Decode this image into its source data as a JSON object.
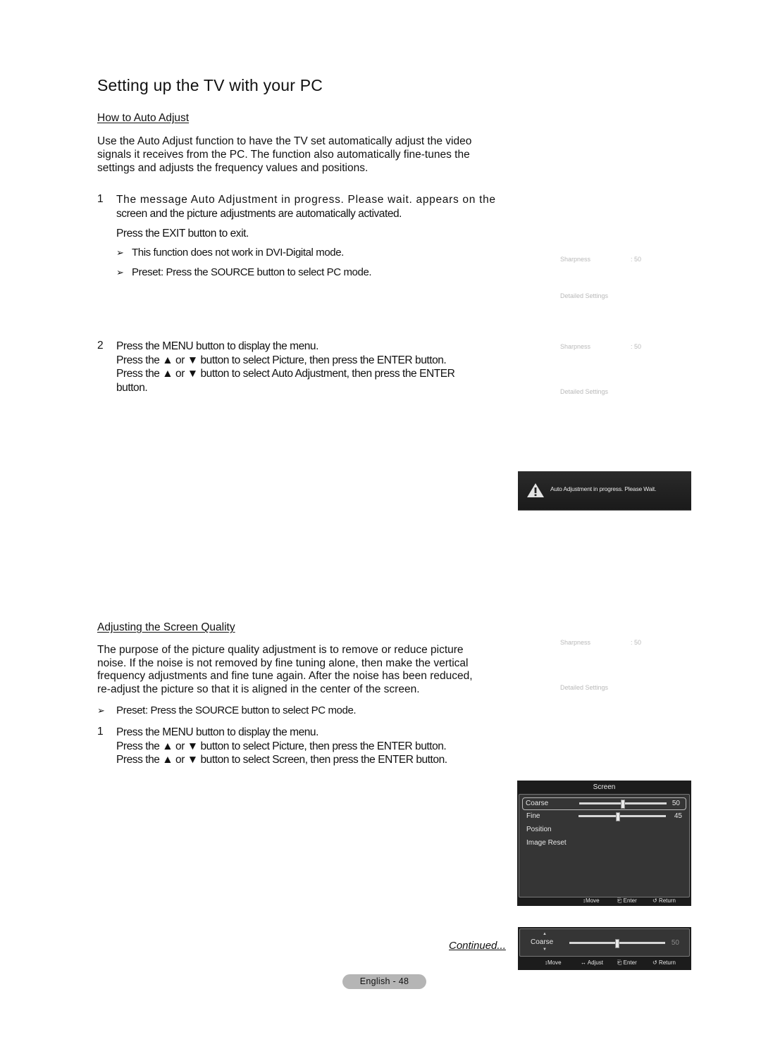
{
  "page": {
    "title": "Setting up the TV with your PC",
    "continued_label": "Continued...",
    "page_label": "English - 48"
  },
  "auto_adjust": {
    "heading": "How to Auto Adjust",
    "intro": [
      "Use the Auto Adjust function to have the TV set automatically adjust the video",
      "signals it receives from the PC. The function also automatically fine-tunes the",
      "settings and adjusts the frequency values and positions."
    ],
    "step1": {
      "number": "1",
      "line1": "The message Auto Adjustment in progress. Please wait. appears on the",
      "line2": "screen and the picture adjustments are automatically activated.",
      "line3": "Press the EXIT button to exit.",
      "notes": [
        "This function does not work in DVI-Digital mode.",
        "Preset: Press the SOURCE button to select PC mode."
      ]
    },
    "step2": {
      "number": "2",
      "lines": [
        "Press the MENU button to display the menu.",
        "Press the ▲ or ▼ button to select Picture, then press the ENTER button.",
        "Press the ▲ or ▼ button to select Auto Adjustment, then press the ENTER",
        "button."
      ]
    }
  },
  "screen_quality": {
    "heading": "Adjusting the Screen Quality",
    "intro": [
      "The purpose of the picture quality adjustment is to remove or reduce picture",
      "noise. If the noise is not removed by fine tuning alone, then make the vertical",
      "frequency adjustments and fine tune again. After the noise has been reduced,",
      "re-adjust the picture so that it is aligned in the center of the screen."
    ],
    "note": "Preset: Press the SOURCE button to select PC mode.",
    "step1": {
      "number": "1",
      "lines": [
        "Press the MENU button to display the menu.",
        "Press the ▲ or ▼ button to select Picture, then press the ENTER button.",
        "Press the ▲ or ▼ button to select Screen, then press the ENTER button."
      ]
    }
  },
  "faint_menus": [
    {
      "sharpness_label": "Sharpness",
      "sharpness_value": ": 50",
      "detailed_label": "Detailed Settings"
    },
    {
      "sharpness_label": "Sharpness",
      "sharpness_value": ": 50",
      "detailed_label": "Detailed Settings"
    },
    {
      "sharpness_label": "Sharpness",
      "sharpness_value": ": 50",
      "detailed_label": "Detailed Settings"
    }
  ],
  "popup": {
    "icon": "warning-icon",
    "message": "Auto Adjustment in progress. Please Wait."
  },
  "screen_menu": {
    "title": "Screen",
    "items": [
      {
        "label": "Coarse",
        "value": "50",
        "level": 0.5,
        "selected": true
      },
      {
        "label": "Fine",
        "value": "45",
        "level": 0.45,
        "selected": false
      },
      {
        "label": "Position"
      },
      {
        "label": "Image Reset"
      }
    ],
    "footer": {
      "move": "Move",
      "enter": "Enter",
      "return": "Return"
    }
  },
  "coarse_bar": {
    "label": "Coarse",
    "value": "50",
    "level": 0.5,
    "footer": {
      "move": "Move",
      "adjust": "Adjust",
      "enter": "Enter",
      "return": "Return"
    }
  },
  "colors": {
    "osd_bg": "#1c1c1c",
    "osd_panel": "#353535",
    "osd_text": "#e6e6e6",
    "faint_text": "#b9b9b9",
    "page_pill": "#b5b5b5"
  }
}
